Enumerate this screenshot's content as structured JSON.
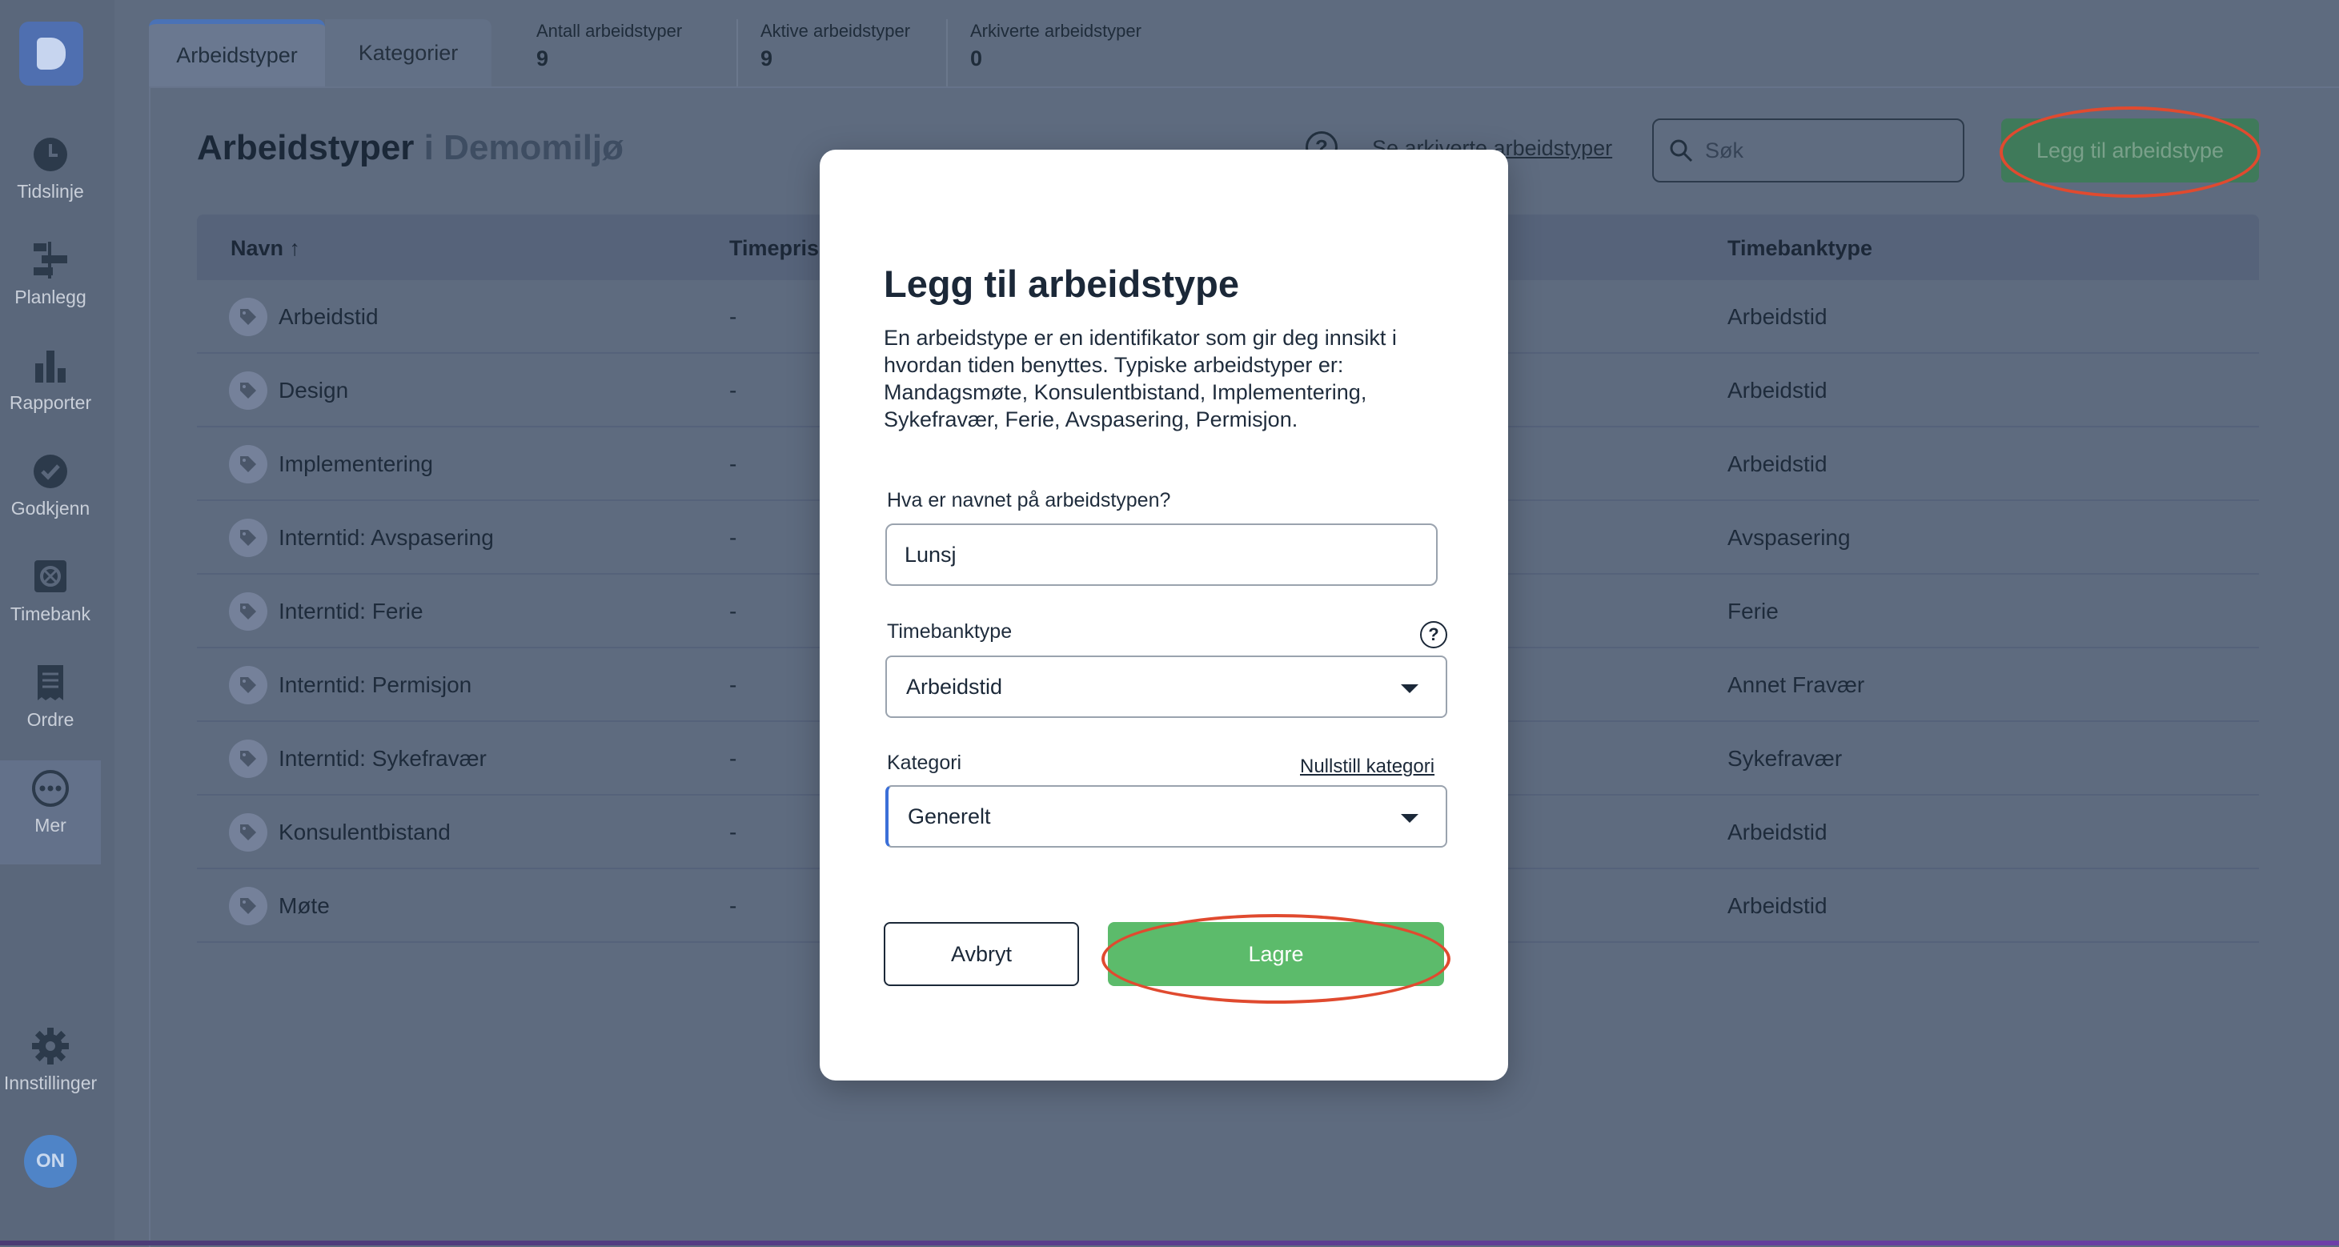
{
  "colors": {
    "accent_green": "#5cbb6b",
    "annotation_ring": "#e04a2f",
    "tab_active_indicator": "#4a72b6",
    "avatar_bg": "#4f84c7"
  },
  "sidebar": {
    "items": [
      {
        "label": "Tidslinje",
        "icon": "clock-icon"
      },
      {
        "label": "Planlegg",
        "icon": "planner-icon"
      },
      {
        "label": "Rapporter",
        "icon": "bar-chart-icon"
      },
      {
        "label": "Godkjenn",
        "icon": "check-circle-icon"
      },
      {
        "label": "Timebank",
        "icon": "safe-icon"
      },
      {
        "label": "Ordre",
        "icon": "receipt-icon"
      },
      {
        "label": "Mer",
        "icon": "more-icon"
      }
    ],
    "settings_label": "Innstillinger",
    "avatar_initials": "ON"
  },
  "tabs": [
    {
      "label": "Arbeidstyper",
      "active": true
    },
    {
      "label": "Kategorier",
      "active": false
    }
  ],
  "stats": [
    {
      "label": "Antall arbeidstyper",
      "value": "9"
    },
    {
      "label": "Aktive arbeidstyper",
      "value": "9"
    },
    {
      "label": "Arkiverte arbeidstyper",
      "value": "0"
    }
  ],
  "header": {
    "title": "Arbeidstyper",
    "environment": "i Demomiljø",
    "archived_link": "Se arkiverte arbeidstyper",
    "search_placeholder": "Søk",
    "add_button": "Legg til arbeidstype"
  },
  "table": {
    "columns": [
      "Navn ↑",
      "Timepris",
      "Timebanktype"
    ],
    "rows": [
      {
        "name": "Arbeidstid",
        "price": "-",
        "bank_type": "Arbeidstid"
      },
      {
        "name": "Design",
        "price": "-",
        "bank_type": "Arbeidstid"
      },
      {
        "name": "Implementering",
        "price": "-",
        "bank_type": "Arbeidstid"
      },
      {
        "name": "Interntid: Avspasering",
        "price": "-",
        "bank_type": "Avspasering"
      },
      {
        "name": "Interntid: Ferie",
        "price": "-",
        "bank_type": "Ferie"
      },
      {
        "name": "Interntid: Permisjon",
        "price": "-",
        "bank_type": "Annet Fravær"
      },
      {
        "name": "Interntid: Sykefravær",
        "price": "-",
        "bank_type": "Sykefravær"
      },
      {
        "name": "Konsulentbistand",
        "price": "-",
        "bank_type": "Arbeidstid"
      },
      {
        "name": "Møte",
        "price": "-",
        "bank_type": "Arbeidstid"
      }
    ]
  },
  "modal": {
    "title": "Legg til arbeidstype",
    "description": "En arbeidstype er en identifikator som gir deg innsikt i hvordan tiden benyttes. Typiske arbeidstyper er: Mandagsmøte, Konsulentbistand, Implementering, Sykefravær, Ferie, Avspasering, Permisjon.",
    "name_label": "Hva er navnet på arbeidstypen?",
    "name_value": "Lunsj",
    "bank_type_label": "Timebanktype",
    "bank_type_value": "Arbeidstid",
    "category_label": "Kategori",
    "category_reset": "Nullstill kategori",
    "category_value": "Generelt",
    "cancel_button": "Avbryt",
    "save_button": "Lagre"
  }
}
